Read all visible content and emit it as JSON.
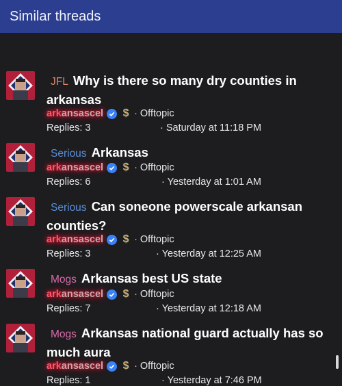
{
  "header": {
    "title": "Similar threads"
  },
  "threads": [
    {
      "prefix": "JFL",
      "prefix_color": "#e0896a",
      "title": "Why is there so many dry counties in arkansas",
      "user_hl": "ark",
      "user_rest": "ansascel",
      "forum": "Offtopic",
      "replies": "Replies: 3",
      "date": "Saturday at 11:18 PM"
    },
    {
      "prefix": "Serious",
      "prefix_color": "#5b8fd6",
      "title": "Arkansas",
      "user_hl": "ark",
      "user_rest": "ansascel",
      "forum": "Offtopic",
      "replies": "Replies: 6",
      "date": "Yesterday at 1:01 AM"
    },
    {
      "prefix": "Serious",
      "prefix_color": "#5b8fd6",
      "title": "Can soneone powerscale arkansan counties?",
      "user_hl": "ark",
      "user_rest": "ansascel",
      "forum": "Offtopic",
      "replies": "Replies: 3",
      "date": "Yesterday at 12:25 AM"
    },
    {
      "prefix": "Mogs",
      "prefix_color": "#d86aa8",
      "title": "Arkansas best US state",
      "user_hl": "ark",
      "user_rest": "ansascel",
      "forum": "Offtopic",
      "replies": "Replies: 7",
      "date": "Yesterday at 12:18 AM"
    },
    {
      "prefix": "Mogs",
      "prefix_color": "#d86aa8",
      "title": "Arkansas national guard actually has so much aura",
      "user_hl": "ark",
      "user_rest": "ansascel",
      "forum": "Offtopic",
      "replies": "Replies: 1",
      "date": "Yesterday at 7:46 PM"
    }
  ],
  "icons": {
    "verified": "verified-check-icon",
    "dollar": "dollar-badge-icon"
  },
  "colors": {
    "header_bg": "#2c3e8f",
    "page_bg": "#1d1d20",
    "verified_blue": "#3a82f7",
    "username_glow": "#e01a37"
  }
}
